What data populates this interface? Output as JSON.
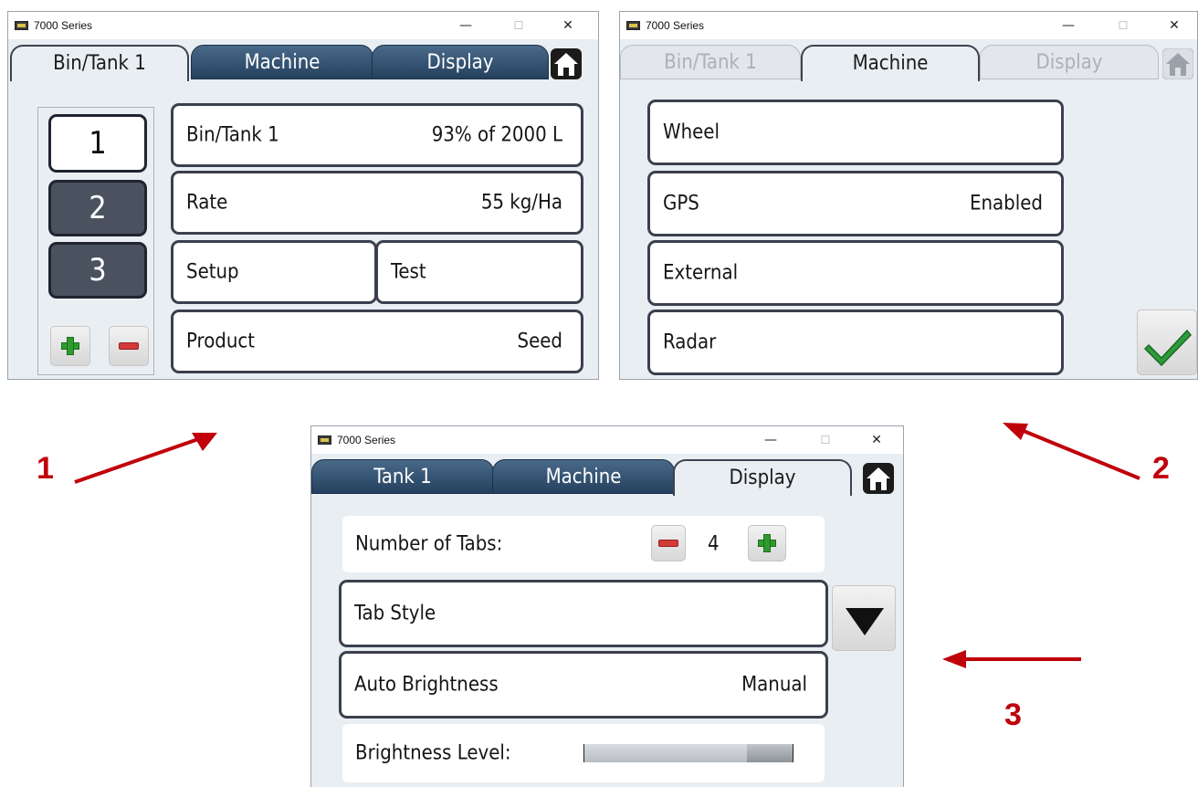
{
  "window1": {
    "title": "7000 Series",
    "tabs": [
      "Bin/Tank 1",
      "Machine",
      "Display"
    ],
    "bin_numbers": [
      "1",
      "2",
      "3"
    ],
    "rows": {
      "bin_tank_label": "Bin/Tank 1",
      "bin_tank_value": "93% of 2000 L",
      "rate_label": "Rate",
      "rate_value": "55 kg/Ha",
      "setup_label": "Setup",
      "test_label": "Test",
      "product_label": "Product",
      "product_value": "Seed"
    }
  },
  "window2": {
    "title": "7000 Series",
    "tabs": [
      "Bin/Tank 1",
      "Machine",
      "Display"
    ],
    "rows": {
      "wheel_label": "Wheel",
      "gps_label": "GPS",
      "gps_value": "Enabled",
      "external_label": "External",
      "radar_label": "Radar"
    }
  },
  "window3": {
    "title": "7000 Series",
    "tabs": [
      "Tank 1",
      "Machine",
      "Display"
    ],
    "rows": {
      "num_tabs_label": "Number of Tabs:",
      "num_tabs_value": "4",
      "tab_style_label": "Tab Style",
      "auto_brightness_label": "Auto Brightness",
      "auto_brightness_value": "Manual",
      "brightness_level_label": "Brightness Level:",
      "brightness_level_fraction": 0.78
    }
  },
  "callouts": [
    "1",
    "2",
    "3"
  ],
  "window_controls": {
    "minimize": "—",
    "maximize": "☐",
    "close": "✕"
  },
  "colors": {
    "tab_dark": "#2c4766",
    "row_border": "#3a404d",
    "arrow_red": "#c0000a",
    "check_green": "#2e9a3a"
  }
}
